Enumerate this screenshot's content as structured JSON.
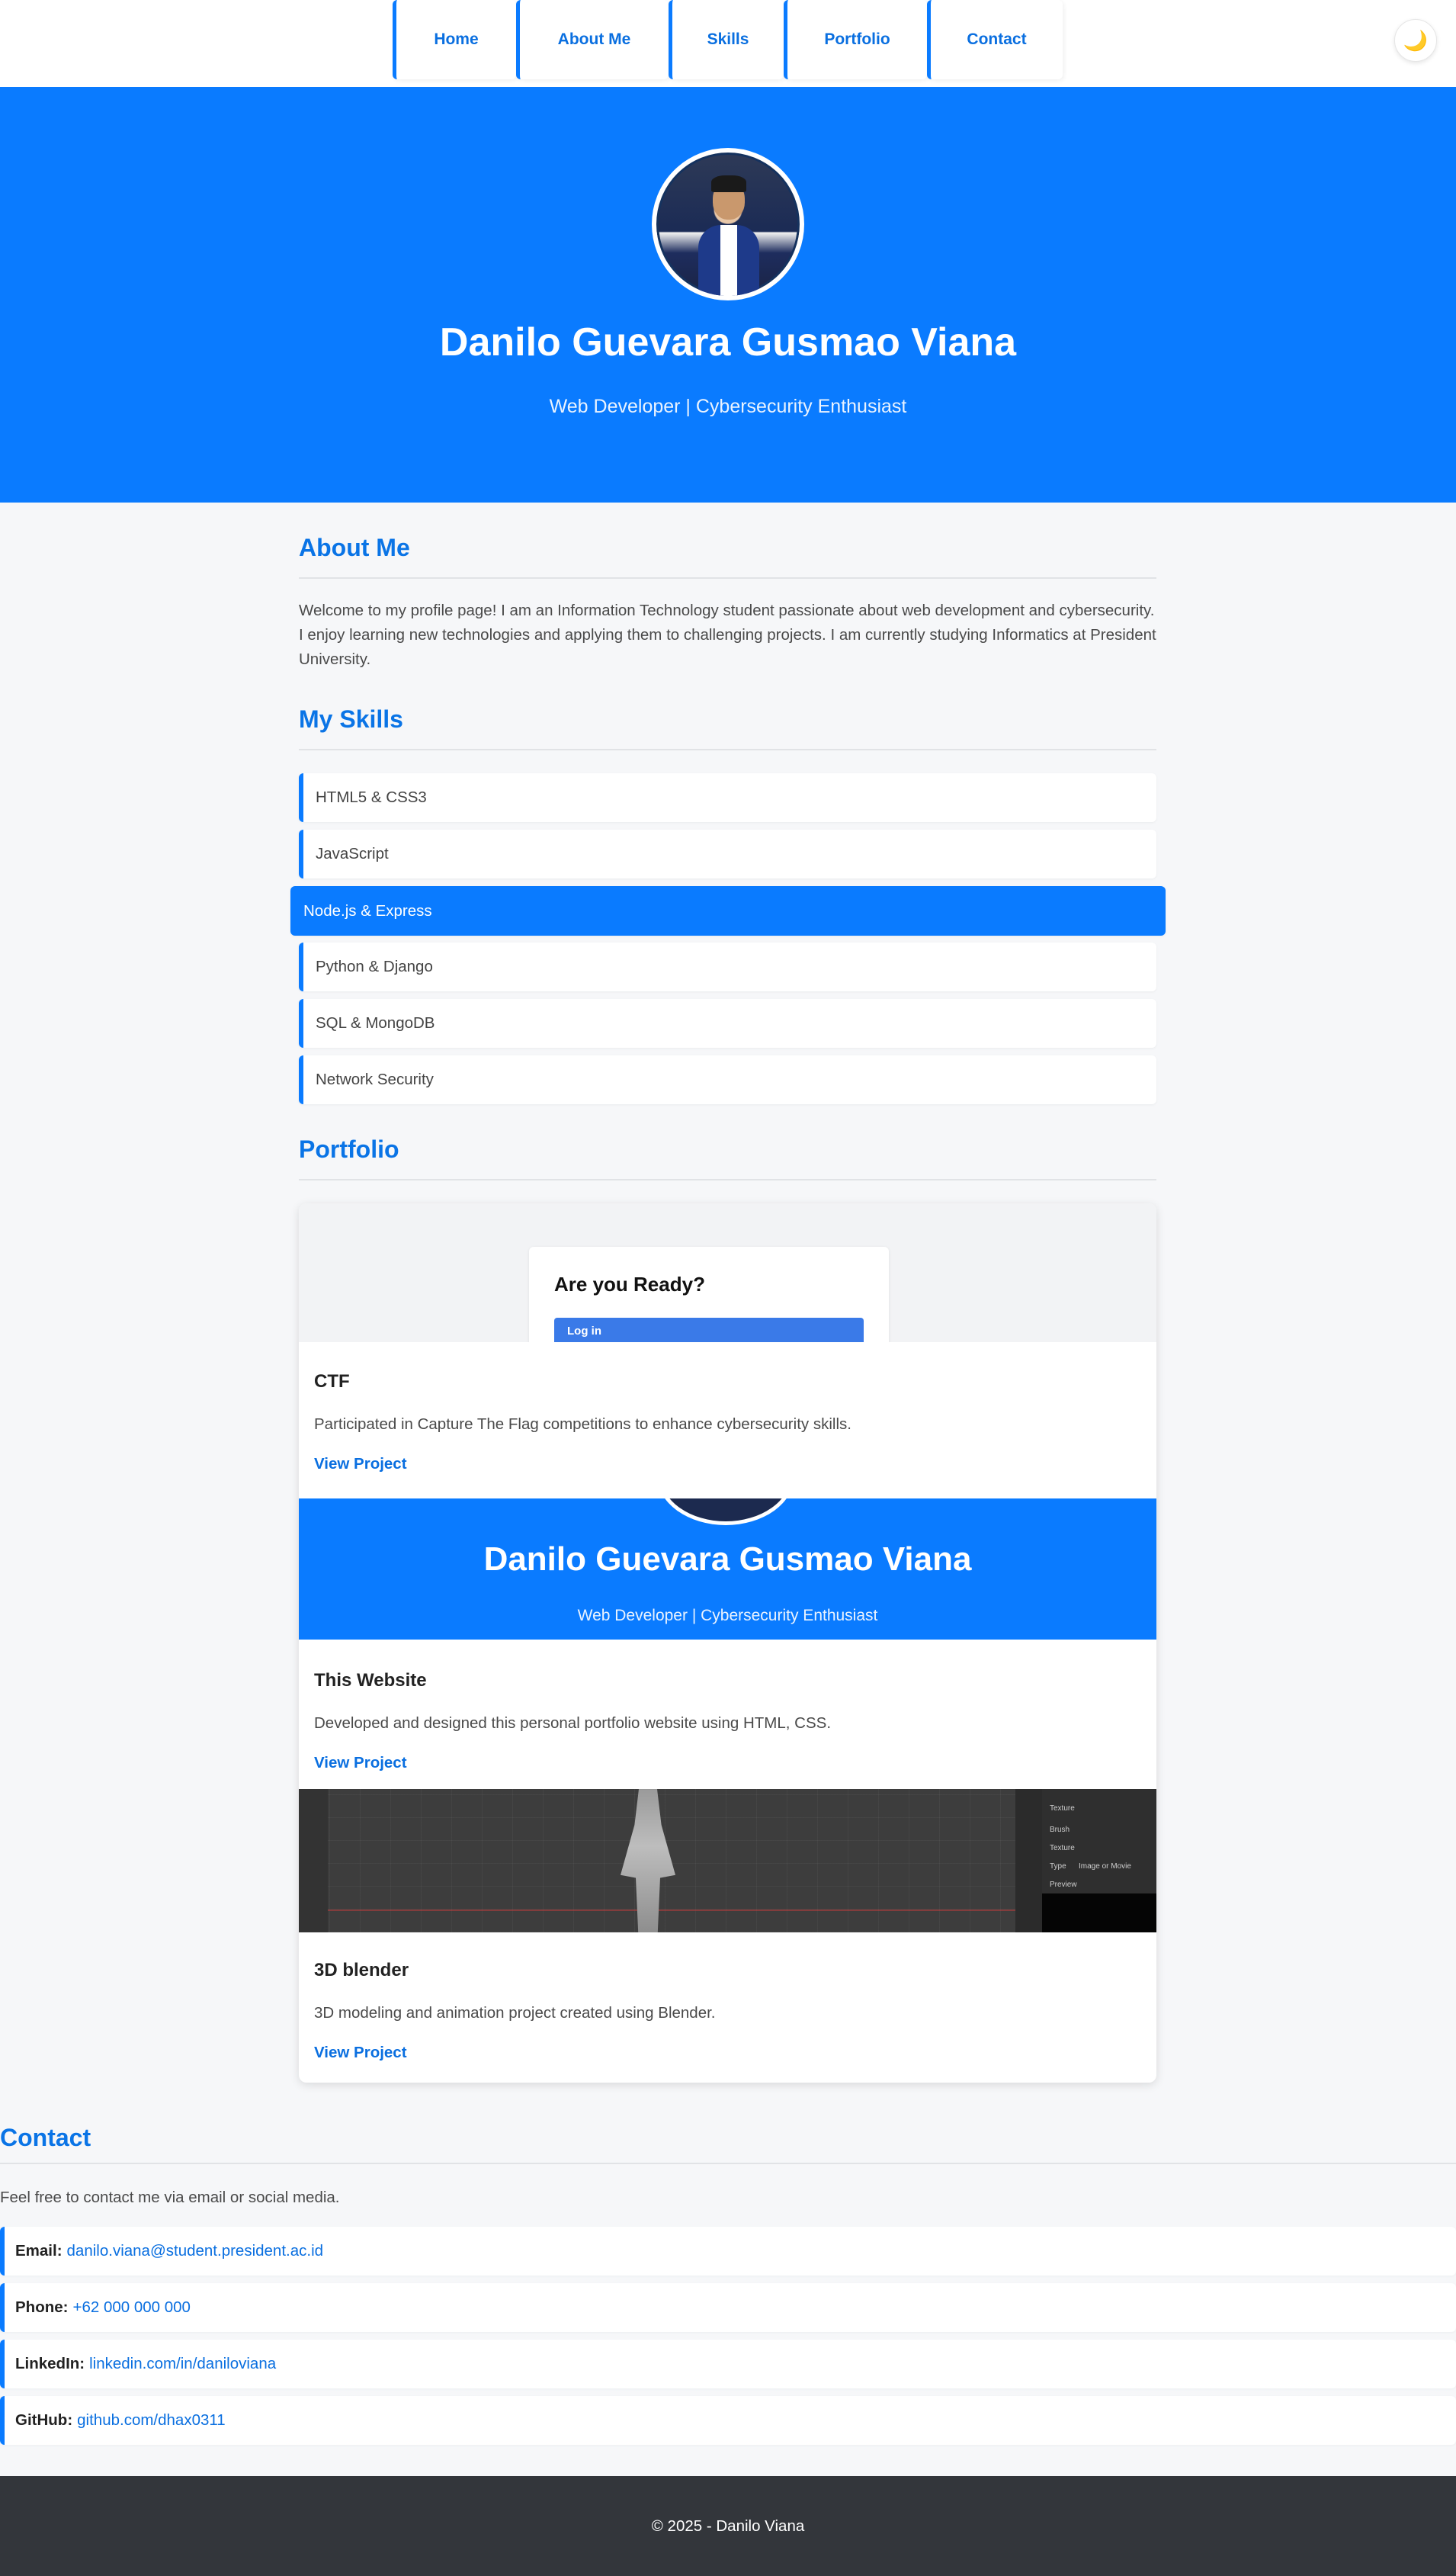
{
  "nav": {
    "items": [
      {
        "label": "Home"
      },
      {
        "label": "About Me"
      },
      {
        "label": "Skills"
      },
      {
        "label": "Portfolio"
      },
      {
        "label": "Contact"
      }
    ],
    "theme_toggle_icon": "moon-icon",
    "theme_toggle_glyph": "🌙"
  },
  "hero": {
    "name": "Danilo Guevara Gusmao Viana",
    "role": "Web Developer | Cybersecurity Enthusiast"
  },
  "about": {
    "title": "About Me",
    "text": "Welcome to my profile page! I am an Information Technology student passionate about web development and cybersecurity. I enjoy learning new technologies and applying them to challenging projects. I am currently studying Informatics at President University."
  },
  "skills": {
    "title": "My Skills",
    "items": [
      {
        "label": "HTML5 & CSS3"
      },
      {
        "label": "JavaScript"
      },
      {
        "label": "Node.js & Express",
        "active": true
      },
      {
        "label": "Python & Django"
      },
      {
        "label": "SQL & MongoDB"
      },
      {
        "label": "Network Security"
      }
    ]
  },
  "portfolio": {
    "title": "Portfolio",
    "projects": [
      {
        "title": "CTF",
        "description": "Participated in Capture The Flag competitions to enhance cybersecurity skills.",
        "link": "View Project",
        "preview": {
          "heading": "Are you Ready?",
          "button": "Log in"
        }
      },
      {
        "title": "This Website",
        "description": "Developed and designed this personal portfolio website using HTML, CSS.",
        "link": "View Project",
        "preview": {
          "name": "Danilo Guevara Gusmao Viana",
          "role": "Web Developer | Cybersecurity Enthusiast"
        }
      },
      {
        "title": "3D blender",
        "description": "3D modeling and animation project created using Blender.",
        "link": "View Project",
        "preview": {
          "labels": [
            "Texture",
            "Brush",
            "Texture",
            "Type",
            "Image or Movie",
            "Preview"
          ]
        }
      }
    ]
  },
  "contact": {
    "title": "Contact",
    "intro": "Feel free to contact me via email or social media.",
    "items": [
      {
        "label": "Email:",
        "value": "danilo.viana@student.president.ac.id"
      },
      {
        "label": "Phone:",
        "value": "+62 000 000 000"
      },
      {
        "label": "LinkedIn:",
        "value": "linkedin.com/in/daniloviana"
      },
      {
        "label": "GitHub:",
        "value": "github.com/dhax0311"
      }
    ]
  },
  "footer": {
    "text": "© 2025 - Danilo Viana"
  },
  "colors": {
    "accent": "#0a7bff",
    "footer_bg": "#33363b",
    "page_bg": "#f6f7f9"
  }
}
